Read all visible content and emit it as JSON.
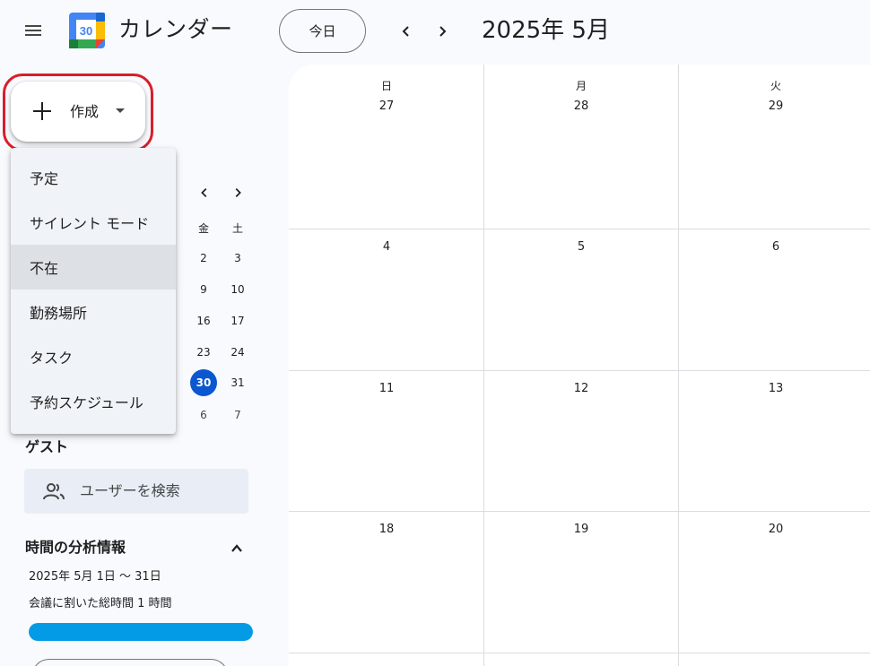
{
  "header": {
    "app_title": "カレンダー",
    "logo_day": "30",
    "today_label": "今日",
    "period_title": "2025年 5月"
  },
  "create": {
    "label": "作成",
    "menu": [
      "予定",
      "サイレント モード",
      "不在",
      "勤務場所",
      "タスク",
      "予約スケジュール"
    ]
  },
  "mini_calendar": {
    "headers": [
      "金",
      "土"
    ],
    "rows": [
      [
        "2",
        "3"
      ],
      [
        "9",
        "10"
      ],
      [
        "16",
        "17"
      ],
      [
        "23",
        "24"
      ],
      [
        "30",
        "31"
      ],
      [
        "6",
        "7"
      ]
    ],
    "today": "30"
  },
  "guests": {
    "title": "ゲスト",
    "search_placeholder": "ユーザーを検索"
  },
  "time_insights": {
    "title": "時間の分析情報",
    "range": "2025年 5月 1日 ～ 31日",
    "meeting_text": "会議に割いた総時間 1 時間",
    "progress_fraction": 1.0
  },
  "month_grid": {
    "weekdays": [
      "日",
      "月",
      "火"
    ],
    "weeks": [
      [
        "27",
        "28",
        "29"
      ],
      [
        "4",
        "5",
        "6"
      ],
      [
        "11",
        "12",
        "13"
      ],
      [
        "18",
        "19",
        "20"
      ]
    ]
  },
  "colors": {
    "accent": "#0b57d0",
    "highlight_outline": "#d81e2a",
    "insight_bar": "#039be5"
  }
}
